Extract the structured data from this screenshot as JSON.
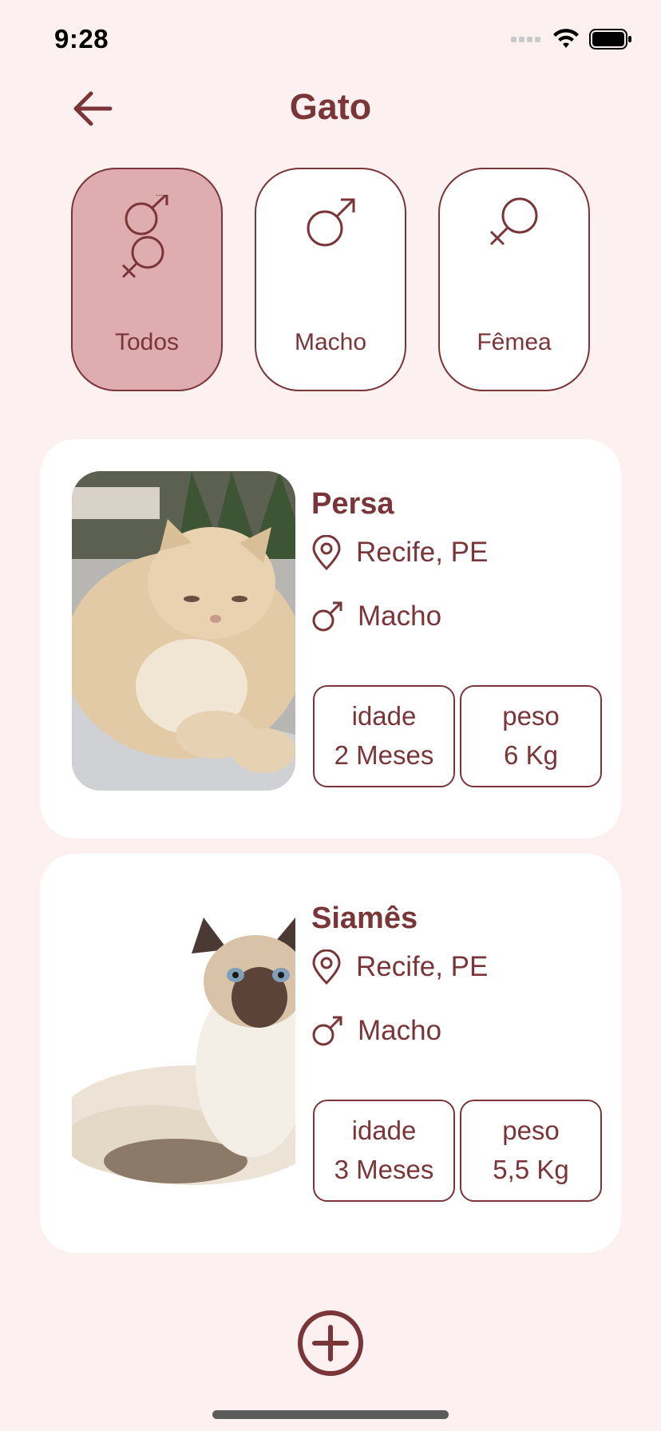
{
  "status_bar": {
    "time": "9:28"
  },
  "header": {
    "title": "Gato"
  },
  "filters": [
    {
      "label": "Todos",
      "icon": "male-female-icon",
      "active": true
    },
    {
      "label": "Macho",
      "icon": "male-icon",
      "active": false
    },
    {
      "label": "Fêmea",
      "icon": "female-icon",
      "active": false
    }
  ],
  "pets": [
    {
      "name": "Persa",
      "location": "Recife, PE",
      "sex": "Macho",
      "age_label": "idade",
      "age_value": "2 Meses",
      "weight_label": "peso",
      "weight_value": "6 Kg"
    },
    {
      "name": "Siamês",
      "location": "Recife, PE",
      "sex": "Macho",
      "age_label": "idade",
      "age_value": "3 Meses",
      "weight_label": "peso",
      "weight_value": "5,5 Kg"
    }
  ],
  "colors": {
    "accent": "#7a3538",
    "active_filter": "#dfacaf",
    "background": "#fdf0f0"
  }
}
